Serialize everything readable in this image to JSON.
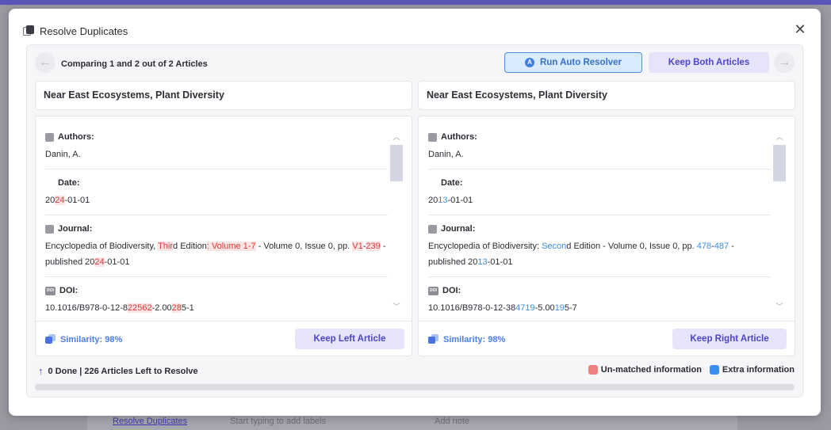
{
  "background": {
    "bottom_bar": {
      "link": "Resolve Duplicates",
      "label_input_placeholder": "Start typing to add labels",
      "note_placeholder": "Add note"
    }
  },
  "modal": {
    "title": "Resolve Duplicates",
    "close_icon": "close-icon",
    "compare_text": "Comparing 1 and 2 out of 2 Articles",
    "run_auto_resolver_label": "Run Auto Resolver",
    "run_auto_icon_letter": "A",
    "keep_both_label": "Keep Both Articles",
    "left": {
      "title": "Near East Ecosystems, Plant Diversity",
      "authors_label": "Authors:",
      "authors_value": "Danin, A.",
      "date_label": "Date:",
      "journal_label": "Journal:",
      "doi_label": "DOI:",
      "doi_icon_text": "DOI",
      "similarity": "Similarity: 98%",
      "keep_label": "Keep Left Article"
    },
    "right": {
      "title": "Near East Ecosystems, Plant Diversity",
      "authors_label": "Authors:",
      "authors_value": "Danin, A.",
      "date_label": "Date:",
      "journal_label": "Journal:",
      "doi_label": "DOI:",
      "doi_icon_text": "DOI",
      "similarity": "Similarity: 98%",
      "keep_label": "Keep Right Article"
    },
    "status": "0 Done | 226 Articles Left to Resolve",
    "legend": {
      "unmatched": "Un-matched information",
      "extra": "Extra information"
    },
    "progress_percent": 0,
    "colors": {
      "unmatched": "#f08080",
      "extra": "#3d8cf0",
      "accent": "#4b45c9"
    }
  }
}
